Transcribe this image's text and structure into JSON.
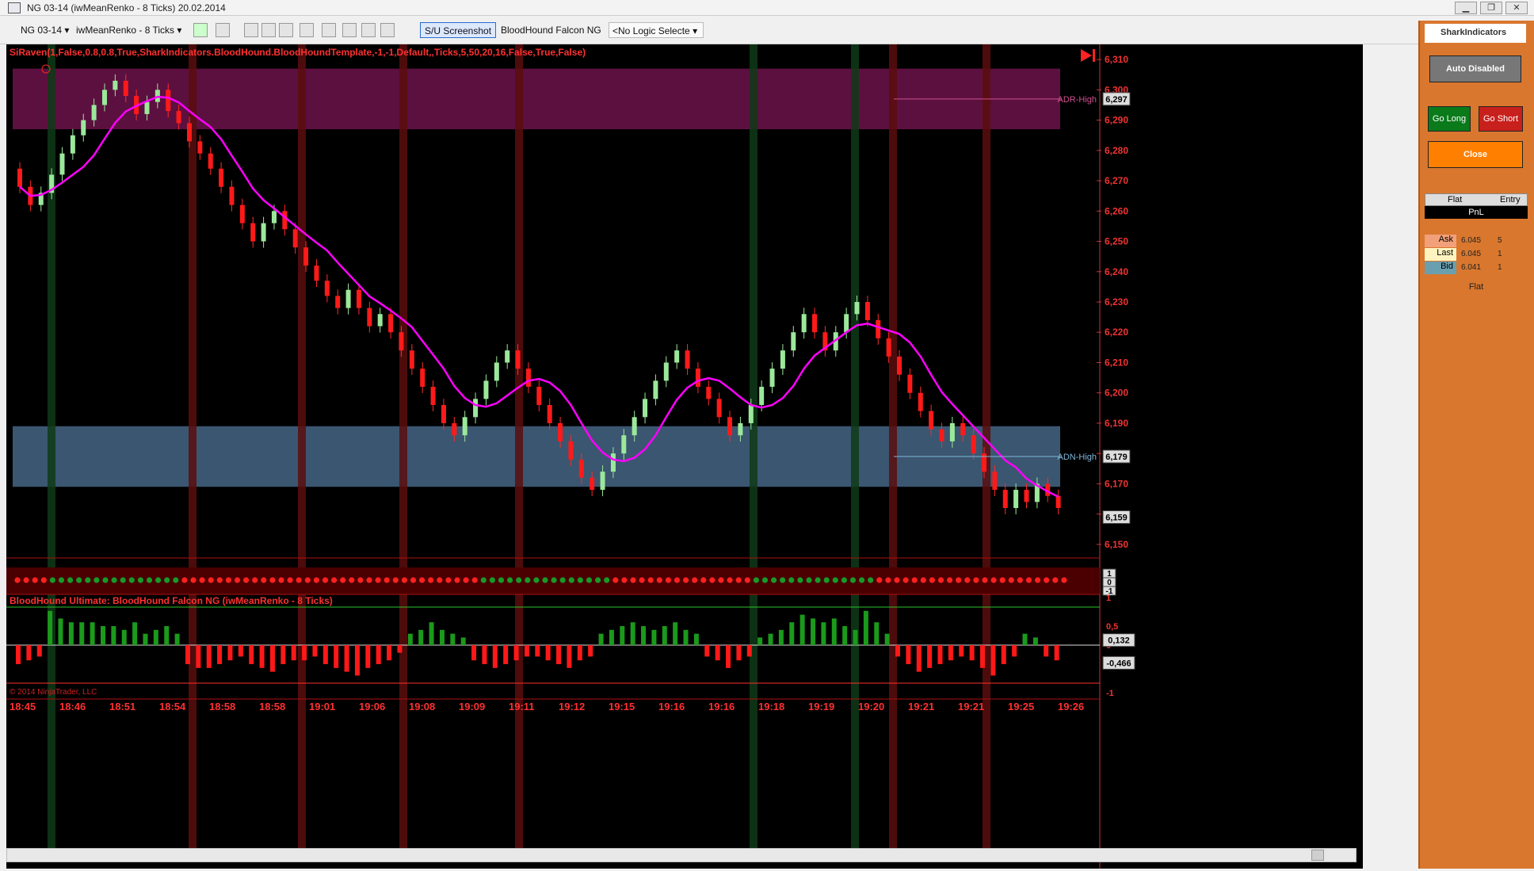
{
  "window": {
    "title": "NG 03-14 (iwMeanRenko - 8 Ticks)  20.02.2014"
  },
  "toolbar": {
    "instrument": "NG 03-14",
    "period": "iwMeanRenko - 8 Ticks",
    "screenshot": "S/U Screenshot",
    "strategy": "BloodHound Falcon NG",
    "logic": "<No Logic Selecte"
  },
  "chart": {
    "indicator_label": "SiRaven(1,False,0.8,0.8,True,SharkIndicators.BloodHound.BloodHoundTemplate,-1,-1,Default,,Ticks,5,50,20,16,False,True,False)",
    "adr_high_label": "ADR-High",
    "adn_high_label": "ADN-High",
    "price_boxes": [
      "6,297",
      "6,179",
      "6,159"
    ],
    "lower_label": "BloodHound Ultimate: BloodHound Falcon NG (iwMeanRenko - 8 Ticks)",
    "copyright": "© 2014 NinjaTrader, LLC",
    "osc_boxes": [
      "0,132",
      "-0,466"
    ],
    "osc_ticks": [
      "1",
      "0,5",
      "0",
      "-0,5",
      "-1"
    ],
    "strip_ticks": [
      "1",
      "0",
      "-1"
    ]
  },
  "chart_data": [
    {
      "type": "candlestick",
      "title": "",
      "ylim": [
        6.145,
        6.315
      ],
      "y_ticks": [
        "6,310",
        "6,300",
        "6,290",
        "6,280",
        "6,270",
        "6,260",
        "6,250",
        "6,240",
        "6,230",
        "6,220",
        "6,210",
        "6,200",
        "6,190",
        "6,180",
        "6,170",
        "6,160",
        "6,150"
      ],
      "x_ticks": [
        "18:45",
        "18:46",
        "18:51",
        "18:54",
        "18:58",
        "18:58",
        "19:01",
        "19:06",
        "19:08",
        "19:09",
        "19:11",
        "19:12",
        "19:15",
        "19:16",
        "19:16",
        "19:18",
        "19:19",
        "19:20",
        "19:21",
        "19:21",
        "19:25",
        "19:26"
      ],
      "closes": [
        6.268,
        6.262,
        6.266,
        6.272,
        6.279,
        6.285,
        6.29,
        6.295,
        6.3,
        6.303,
        6.298,
        6.292,
        6.296,
        6.3,
        6.293,
        6.289,
        6.283,
        6.279,
        6.274,
        6.268,
        6.262,
        6.256,
        6.25,
        6.256,
        6.26,
        6.254,
        6.248,
        6.242,
        6.237,
        6.232,
        6.228,
        6.234,
        6.228,
        6.222,
        6.226,
        6.22,
        6.214,
        6.208,
        6.202,
        6.196,
        6.19,
        6.186,
        6.192,
        6.198,
        6.204,
        6.21,
        6.214,
        6.208,
        6.202,
        6.196,
        6.19,
        6.184,
        6.178,
        6.172,
        6.168,
        6.174,
        6.18,
        6.186,
        6.192,
        6.198,
        6.204,
        6.21,
        6.214,
        6.208,
        6.202,
        6.198,
        6.192,
        6.186,
        6.19,
        6.196,
        6.202,
        6.208,
        6.214,
        6.22,
        6.226,
        6.22,
        6.214,
        6.22,
        6.226,
        6.23,
        6.224,
        6.218,
        6.212,
        6.206,
        6.2,
        6.194,
        6.188,
        6.184,
        6.19,
        6.186,
        6.18,
        6.174,
        6.168,
        6.162,
        6.168,
        6.164,
        6.17,
        6.166,
        6.162
      ],
      "series": [
        {
          "name": "",
          "color": "#ff00ff"
        },
        {
          "name": "",
          "color": "#33ff33"
        }
      ]
    },
    {
      "type": "bar",
      "title": "",
      "ylim": [
        -1,
        1
      ],
      "values": [
        -0.5,
        -0.4,
        -0.3,
        0.9,
        0.7,
        0.6,
        0.6,
        0.6,
        0.5,
        0.5,
        0.4,
        0.6,
        0.3,
        0.4,
        0.5,
        0.3,
        -0.5,
        -0.6,
        -0.6,
        -0.5,
        -0.4,
        -0.3,
        -0.5,
        -0.6,
        -0.7,
        -0.5,
        -0.4,
        -0.4,
        -0.3,
        -0.5,
        -0.6,
        -0.7,
        -0.8,
        -0.6,
        -0.5,
        -0.4,
        -0.2,
        0.3,
        0.4,
        0.6,
        0.4,
        0.3,
        0.2,
        -0.4,
        -0.5,
        -0.6,
        -0.5,
        -0.4,
        -0.3,
        -0.3,
        -0.4,
        -0.5,
        -0.6,
        -0.4,
        -0.3,
        0.3,
        0.4,
        0.5,
        0.6,
        0.5,
        0.4,
        0.5,
        0.6,
        0.4,
        0.3,
        -0.3,
        -0.4,
        -0.6,
        -0.4,
        -0.3,
        0.2,
        0.3,
        0.4,
        0.6,
        0.8,
        0.7,
        0.6,
        0.7,
        0.5,
        0.4,
        0.9,
        0.6,
        0.3,
        -0.3,
        -0.5,
        -0.7,
        -0.6,
        -0.5,
        -0.4,
        -0.3,
        -0.4,
        -0.6,
        -0.8,
        -0.5,
        -0.3,
        0.3,
        0.2,
        -0.3,
        -0.4
      ]
    }
  ],
  "panel": {
    "brand": "SharkIndicators",
    "auto": "Auto Disabled",
    "go_long": "Go Long",
    "go_short": "Go Short",
    "close": "Close",
    "flat_hdr": "Flat",
    "entry_hdr": "Entry",
    "pnl": "PnL",
    "ask_label": "Ask",
    "ask_price": "6.045",
    "ask_size": "5",
    "last_label": "Last",
    "last_price": "6.045",
    "last_size": "1",
    "bid_label": "Bid",
    "bid_price": "6.041",
    "bid_size": "1",
    "status": "Flat"
  }
}
